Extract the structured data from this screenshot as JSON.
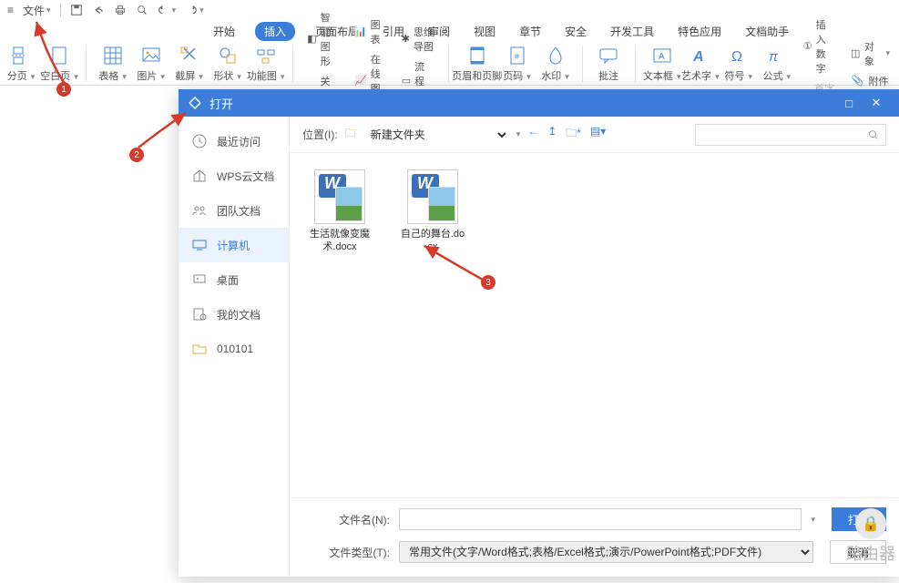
{
  "qat": {
    "file_menu": "文件"
  },
  "tabs": {
    "items": [
      {
        "label": "开始"
      },
      {
        "label": "插入",
        "active": true
      },
      {
        "label": "页面布局"
      },
      {
        "label": "引用"
      },
      {
        "label": "审阅"
      },
      {
        "label": "视图"
      },
      {
        "label": "章节"
      },
      {
        "label": "安全"
      },
      {
        "label": "开发工具"
      },
      {
        "label": "特色应用"
      },
      {
        "label": "文档助手"
      }
    ]
  },
  "ribbon": {
    "page_break": "分页",
    "blank_page": "空白页",
    "table": "表格",
    "picture": "图片",
    "screenshot": "截屏",
    "shapes": "形状",
    "smartart": "功能图",
    "smart_graphic": "智能图形",
    "chart": "图表",
    "relation": "关系图",
    "online_chart": "在线图表",
    "mindmap": "思维导图",
    "flowchart": "流程图",
    "header_footer": "页眉和页脚",
    "page_number": "页码",
    "watermark": "水印",
    "comment": "批注",
    "textbox": "文本框",
    "wordart": "艺术字",
    "symbol": "符号",
    "equation": "公式",
    "insert_number": "插入数字",
    "object": "对象",
    "drop_cap": "首字下沉",
    "attachment": "附件"
  },
  "dialog": {
    "title": "打开",
    "sidebar": {
      "items": [
        {
          "icon": "recent",
          "label": "最近访问"
        },
        {
          "icon": "cloud",
          "label": "WPS云文档"
        },
        {
          "icon": "team",
          "label": "团队文档"
        },
        {
          "icon": "computer",
          "label": "计算机",
          "active": true
        },
        {
          "icon": "desktop",
          "label": "桌面"
        },
        {
          "icon": "mydocs",
          "label": "我的文档"
        },
        {
          "icon": "folder",
          "label": "010101"
        }
      ]
    },
    "loc": {
      "label": "位置(I):",
      "folder": "新建文件夹"
    },
    "files": [
      {
        "name": "生活就像变魔术.docx"
      },
      {
        "name": "自己的舞台.docx"
      }
    ],
    "bottom": {
      "name_label": "文件名(N):",
      "name_value": "",
      "type_label": "文件类型(T):",
      "type_value": "常用文件(文字/Word格式;表格/Excel格式;演示/PowerPoint格式;PDF文件)",
      "open": "打开",
      "cancel": "取消"
    }
  },
  "annotations": {
    "n1": "1",
    "n2": "2",
    "n3": "3"
  },
  "corner": {
    "text": "路由器"
  }
}
